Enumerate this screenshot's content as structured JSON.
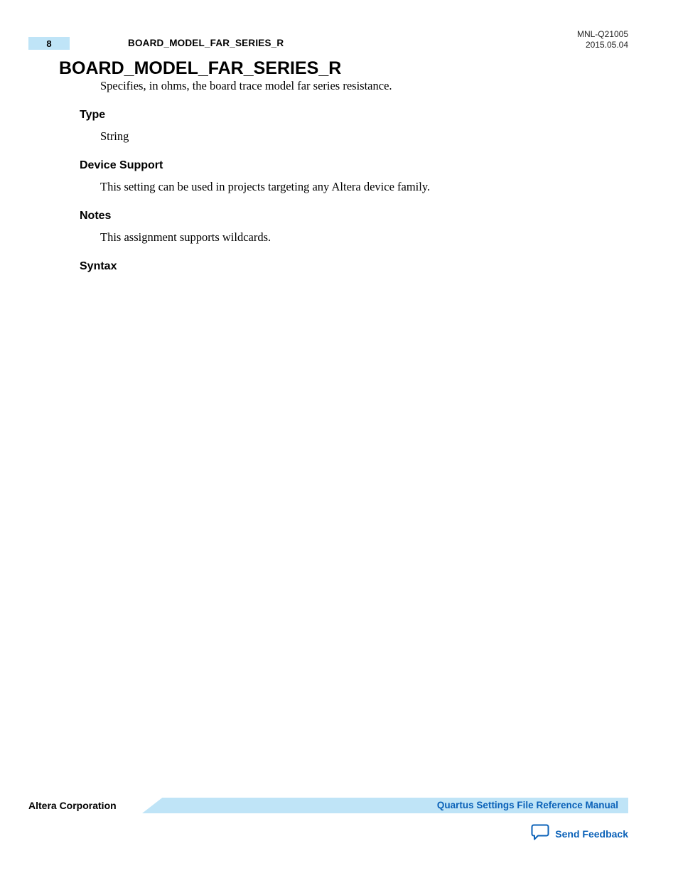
{
  "header": {
    "page_number": "8",
    "running_title": "BOARD_MODEL_FAR_SERIES_R",
    "doc_id": "MNL-Q21005",
    "doc_date": "2015.05.04"
  },
  "main": {
    "title": "BOARD_MODEL_FAR_SERIES_R",
    "intro": "Specifies, in ohms, the board trace model far series resistance.",
    "sections": {
      "type": {
        "heading": "Type",
        "body": "String"
      },
      "device_support": {
        "heading": "Device Support",
        "body": "This setting can be used in projects targeting any Altera device family."
      },
      "notes": {
        "heading": "Notes",
        "body": "This assignment supports wildcards."
      },
      "syntax": {
        "heading": "Syntax"
      }
    }
  },
  "footer": {
    "company": "Altera Corporation",
    "manual_link": "Quartus Settings File Reference Manual",
    "feedback": "Send Feedback"
  },
  "colors": {
    "accent_light": "#bfe4f7",
    "link_blue": "#0a61b8"
  }
}
